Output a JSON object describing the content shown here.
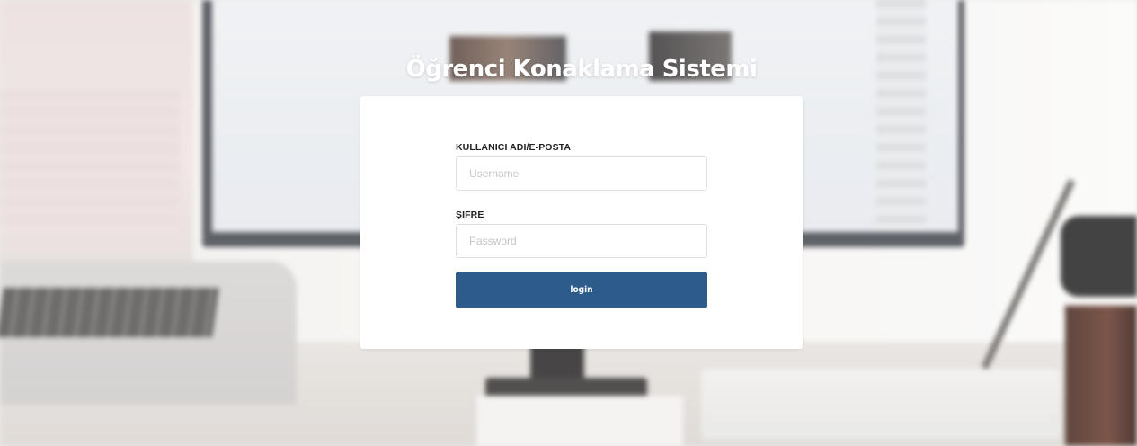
{
  "page": {
    "title": "Öğrenci Konaklama Sistemi"
  },
  "login_form": {
    "username_label": "KULLANICI ADI/E-POSTA",
    "username_placeholder": "Username",
    "username_value": "",
    "password_label": "ŞIFRE",
    "password_placeholder": "Password",
    "password_value": "",
    "submit_label": "login"
  },
  "colors": {
    "primary_button": "#2e5c8a",
    "card_background": "#ffffff",
    "title_text": "#ffffff"
  }
}
